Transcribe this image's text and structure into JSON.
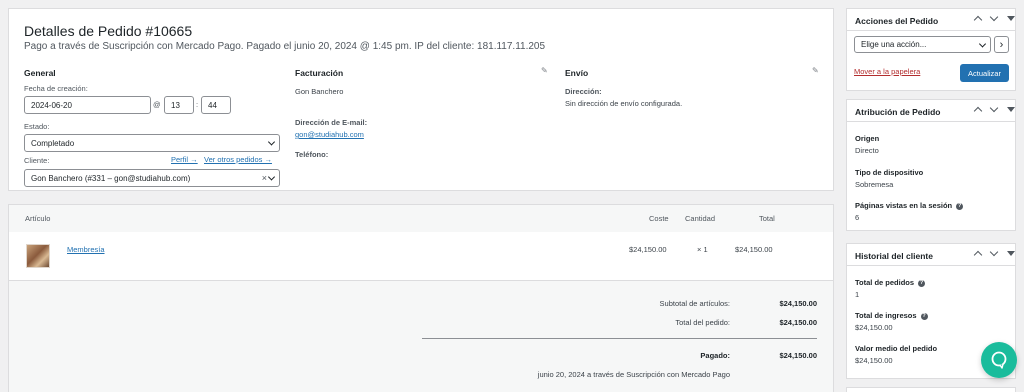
{
  "order": {
    "title": "Detalles de Pedido #10665",
    "subtitle": "Pago a través de Suscripción con Mercado Pago. Pagado el junio 20, 2024 @ 1:45 pm. IP del cliente: 181.117.11.205"
  },
  "general": {
    "heading": "General",
    "date_label": "Fecha de creación:",
    "date_value": "2024-06-20",
    "at": "@",
    "hour": "13",
    "colon": ":",
    "minute": "44",
    "status_label": "Estado:",
    "status_value": "Completado",
    "customer_label": "Cliente:",
    "profile_link": "Perfil →",
    "other_orders_link": "Ver otros pedidos →",
    "customer_value": "Gon Banchero (#331 – gon@studiahub.com)",
    "clear": "×"
  },
  "billing": {
    "heading": "Facturación",
    "name": "Gon Banchero",
    "email_label": "Dirección de E-mail:",
    "email": "gon@studiahub.com",
    "phone_label": "Teléfono:"
  },
  "shipping": {
    "heading": "Envío",
    "address_label": "Dirección:",
    "address_value": "Sin dirección de envío configurada."
  },
  "items": {
    "headers": {
      "item": "Artículo",
      "cost": "Coste",
      "qty": "Cantidad",
      "total": "Total"
    },
    "rows": [
      {
        "name": "Membresía",
        "cost": "$24,150.00",
        "qty": "× 1",
        "total": "$24,150.00"
      }
    ],
    "subtotal_label": "Subtotal de artículos:",
    "subtotal": "$24,150.00",
    "order_total_label": "Total del pedido:",
    "order_total": "$24,150.00",
    "paid_label": "Pagado:",
    "paid": "$24,150.00",
    "paid_note": "junio 20, 2024 a través de Suscripción con Mercado Pago"
  },
  "actions_box": {
    "title": "Acciones del Pedido",
    "select": "Elige una acción...",
    "go": "›",
    "trash": "Mover a la papelera",
    "update": "Actualizar"
  },
  "attribution_box": {
    "title": "Atribución de Pedido",
    "origin_label": "Origen",
    "origin": "Directo",
    "device_label": "Tipo de dispositivo",
    "device": "Sobremesa",
    "pages_label": "Páginas vistas en la sesión",
    "pages": "6"
  },
  "history_box": {
    "title": "Historial del cliente",
    "orders_label": "Total de pedidos",
    "orders": "1",
    "revenue_label": "Total de ingresos",
    "revenue": "$24,150.00",
    "avg_label": "Valor medio del pedido",
    "avg": "$24,150.00"
  },
  "icons": {
    "help": "?",
    "edit": "✎"
  },
  "colors": {
    "link": "#2271b1",
    "primary_button": "#2271b1",
    "trash": "#b32d2e",
    "chat_button": "#1abc9c"
  }
}
